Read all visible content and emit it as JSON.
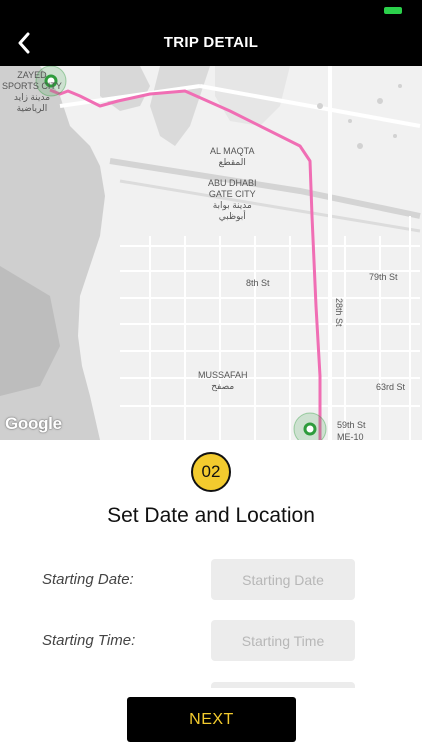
{
  "header": {
    "title": "TRIP DETAIL",
    "back_icon": "chevron-left-icon"
  },
  "status_bar": {
    "battery_color": "#2bd04b"
  },
  "map": {
    "route_color": "#f06eb4",
    "labels": {
      "zayed": "ZAYED\nSPORTS CITY\nمدينة زايد\nالرياضية",
      "al_maqta": "AL MAQTA\nالمقطع",
      "abu_dhabi_gate": "ABU DHABI\nGATE CITY\nمدينة بوابة\nأبوظبي",
      "eighth_st": "8th St",
      "seventy_ninth_st": "79th St",
      "twenty_eighth_st": "28th St",
      "mussafah": "MUSSAFAH\nمصفح",
      "sixty_third_st": "63rd St",
      "fifty_ninth_st": "59th St",
      "road_code": "ME-10"
    },
    "attribution": "Google"
  },
  "step": {
    "number": "02",
    "title": "Set Date and Location"
  },
  "form": {
    "starting_date": {
      "label": "Starting Date:",
      "placeholder": "Starting Date"
    },
    "starting_time": {
      "label": "Starting Time:",
      "placeholder": "Starting Time"
    }
  },
  "actions": {
    "next_label": "NEXT"
  },
  "colors": {
    "accent_yellow": "#f3cb2e",
    "header_bg": "#000000"
  }
}
